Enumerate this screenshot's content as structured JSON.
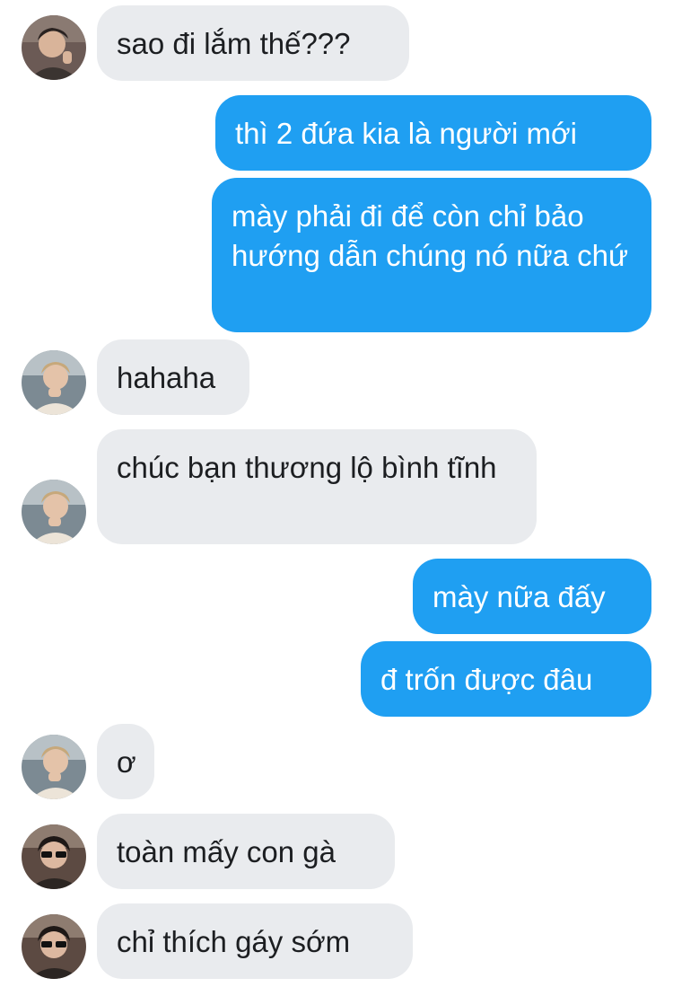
{
  "messages": [
    {
      "id": "m1",
      "sender": "friend-a",
      "direction": "incoming",
      "text": "sao đi lắm thế???"
    },
    {
      "id": "m2",
      "sender": "me",
      "direction": "outgoing",
      "text": "thì 2 đứa kia là người mới"
    },
    {
      "id": "m3",
      "sender": "me",
      "direction": "outgoing",
      "text": "mày phải đi để còn chỉ bảo hướng dẫn chúng nó nữa chứ"
    },
    {
      "id": "m4",
      "sender": "friend-b",
      "direction": "incoming",
      "text": "hahaha"
    },
    {
      "id": "m5",
      "sender": "friend-b",
      "direction": "incoming",
      "text": "chúc bạn thương lộ bình tĩnh"
    },
    {
      "id": "m6",
      "sender": "me",
      "direction": "outgoing",
      "text": "mày nữa đấy"
    },
    {
      "id": "m7",
      "sender": "me",
      "direction": "outgoing",
      "text": "đ trốn được đâu"
    },
    {
      "id": "m8",
      "sender": "friend-b",
      "direction": "incoming",
      "text": "ơ"
    },
    {
      "id": "m9",
      "sender": "friend-c",
      "direction": "incoming",
      "text": "toàn mấy con gà"
    },
    {
      "id": "m10",
      "sender": "friend-c",
      "direction": "incoming",
      "text": "chỉ thích gáy sớm"
    }
  ],
  "colors": {
    "incoming_bubble": "#e9ebee",
    "outgoing_bubble": "#1f9ff2",
    "incoming_text": "#1c1e21",
    "outgoing_text": "#ffffff"
  }
}
